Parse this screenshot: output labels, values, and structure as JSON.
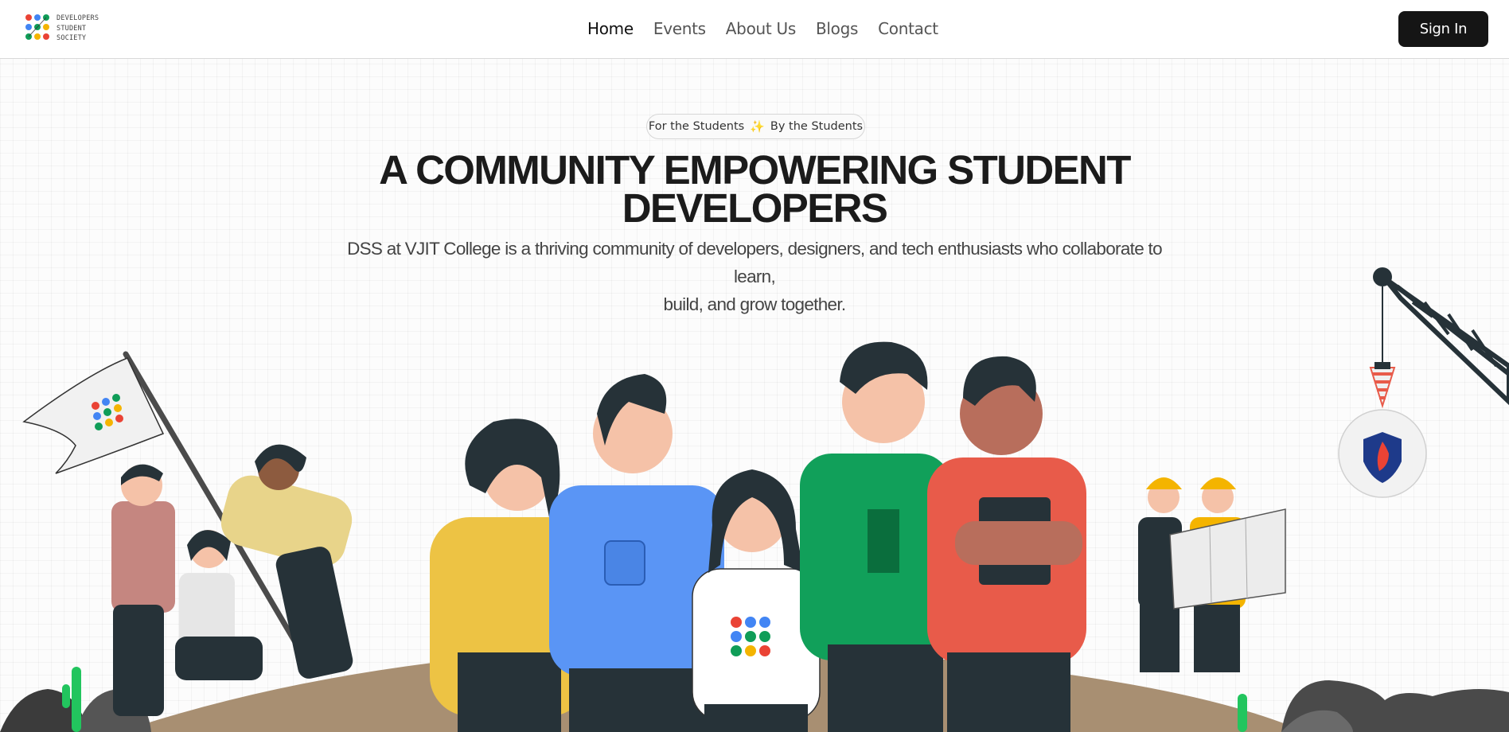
{
  "header": {
    "logo": {
      "lines": [
        "DEVELOPERS",
        "STUDENT",
        "SOCIETY"
      ]
    },
    "nav": [
      {
        "label": "Home",
        "active": true
      },
      {
        "label": "Events",
        "active": false
      },
      {
        "label": "About Us",
        "active": false
      },
      {
        "label": "Blogs",
        "active": false
      },
      {
        "label": "Contact",
        "active": false
      }
    ],
    "sign_in_label": "Sign In"
  },
  "hero": {
    "pill_left": "For the Students",
    "pill_icon": "sparkles-icon",
    "pill_right": "By the Students",
    "headline_line1": "A COMMUNITY EMPOWERING STUDENT",
    "headline_line2": "DEVELOPERS",
    "subtitle_line1": "DSS at VJIT College is a thriving community of developers, designers, and tech enthusiasts who collaborate to learn,",
    "subtitle_line2": "build, and grow together."
  },
  "colors": {
    "brand_red": "#ea4335",
    "brand_blue": "#4285f4",
    "brand_green": "#0f9d58",
    "brand_yellow": "#f4b400",
    "button_dark": "#151515"
  }
}
